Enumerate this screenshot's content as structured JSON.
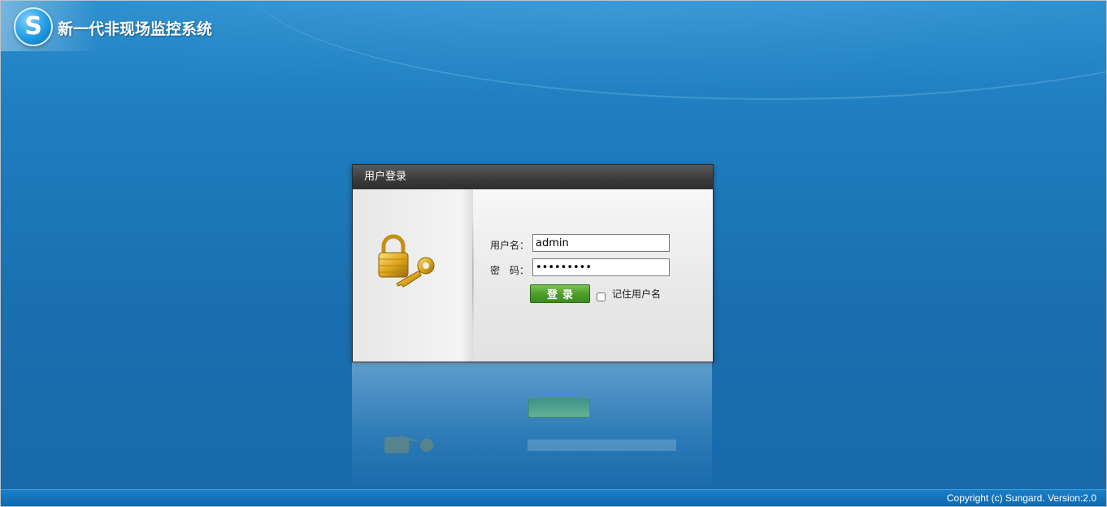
{
  "app": {
    "title": "新一代非现场监控系统",
    "logo_letter": "S"
  },
  "login": {
    "header": "用户登录",
    "username_label": "用户名：",
    "username_value": "admin",
    "password_label": "密　码：",
    "password_value": "123456789",
    "submit_label": "登录",
    "remember_label": "记住用户名",
    "remember_checked": false
  },
  "footer": {
    "copyright": "Copyright (c) Sungard. Version:2.0"
  },
  "icons": {
    "logo": "skype-style-s-logo-icon",
    "lock": "padlock-with-key-icon"
  },
  "colors": {
    "background": "#1a6fb0",
    "login_header": "#3a3a3a",
    "login_button": "#4f9e2c"
  }
}
